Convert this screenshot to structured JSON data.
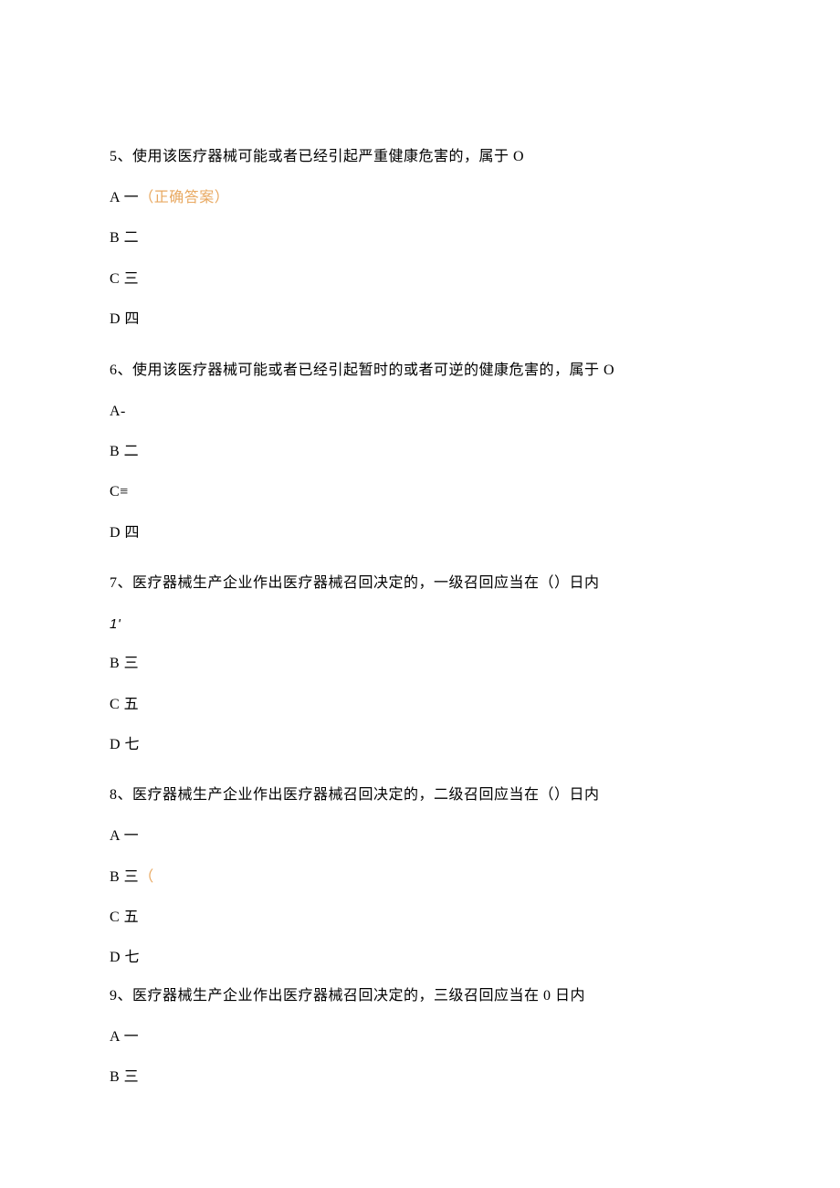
{
  "questions": [
    {
      "number": "5、",
      "text": "使用该医疗器械可能或者已经引起严重健康危害的，属于 O",
      "options": [
        {
          "label": "A 一",
          "correct_suffix": "（正确答案）"
        },
        {
          "label": "B 二"
        },
        {
          "label": "C 三"
        },
        {
          "label": "D 四"
        }
      ]
    },
    {
      "number": "6、",
      "text": "使用该医疗器械可能或者已经引起暂时的或者可逆的健康危害的，属于 O",
      "options": [
        {
          "label": "A-"
        },
        {
          "label": "B 二"
        },
        {
          "label": "C≡"
        },
        {
          "label": "D 四"
        }
      ]
    },
    {
      "number": "7、",
      "text": "医疗器械生产企业作出医疗器械召回决定的，一级召回应当在（）日内",
      "italic_first": "1'",
      "options": [
        {
          "label": "B 三"
        },
        {
          "label": "C 五"
        },
        {
          "label": "D 七"
        }
      ]
    },
    {
      "number": "8、",
      "text": "医疗器械生产企业作出医疗器械召回决定的，二级召回应当在（）日内",
      "options": [
        {
          "label": "A 一"
        },
        {
          "label": "B 三",
          "paren_suffix": "（"
        },
        {
          "label": "C 五"
        },
        {
          "label": "D 七"
        }
      ]
    },
    {
      "number": "9、",
      "text": "医疗器械生产企业作出医疗器械召回决定的，三级召回应当在 0 日内",
      "options": [
        {
          "label": "A 一"
        },
        {
          "label": "B 三"
        }
      ]
    }
  ]
}
